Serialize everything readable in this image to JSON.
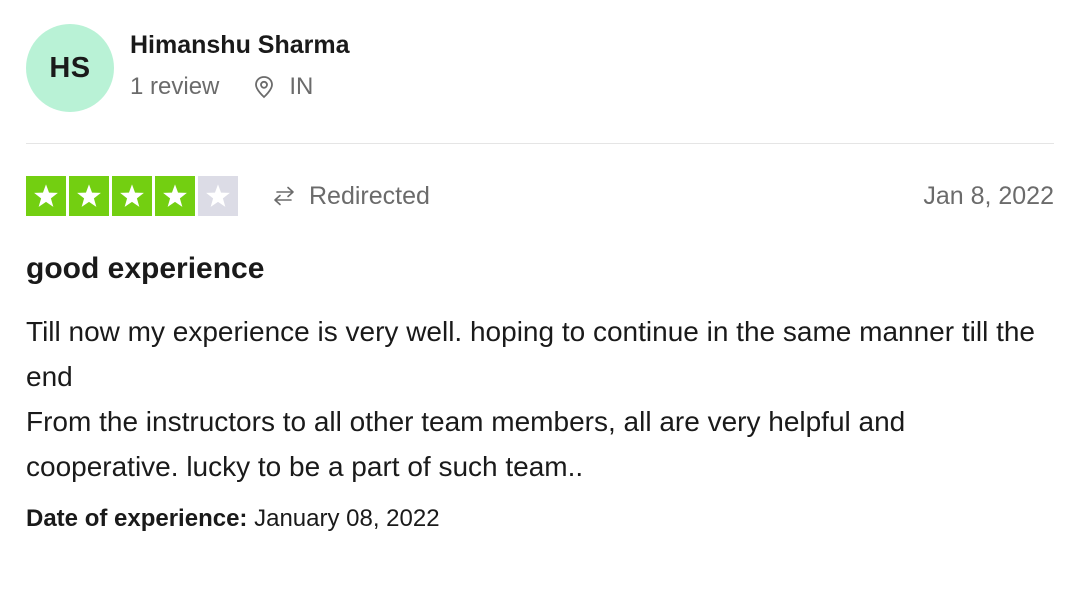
{
  "reviewer": {
    "initials": "HS",
    "name": "Himanshu Sharma",
    "review_count": "1 review",
    "country": "IN"
  },
  "review": {
    "rating": 4,
    "max_rating": 5,
    "source_label": "Redirected",
    "date": "Jan 8, 2022",
    "title": "good experience",
    "paragraphs": [
      "Till now my experience is very well. hoping to continue in the same manner till the end",
      "From the instructors to all other team members, all are very helpful and cooperative. lucky to be a part of such team.."
    ],
    "experience_label": "Date of experience:",
    "experience_date": "January 08, 2022"
  },
  "colors": {
    "avatar_bg": "#b9f2d6",
    "star_filled": "#73cf11",
    "star_empty": "#dcdce6"
  },
  "icons": {
    "location": "location-pin-icon",
    "redirect": "redirect-arrow-icon",
    "star": "star-icon"
  }
}
